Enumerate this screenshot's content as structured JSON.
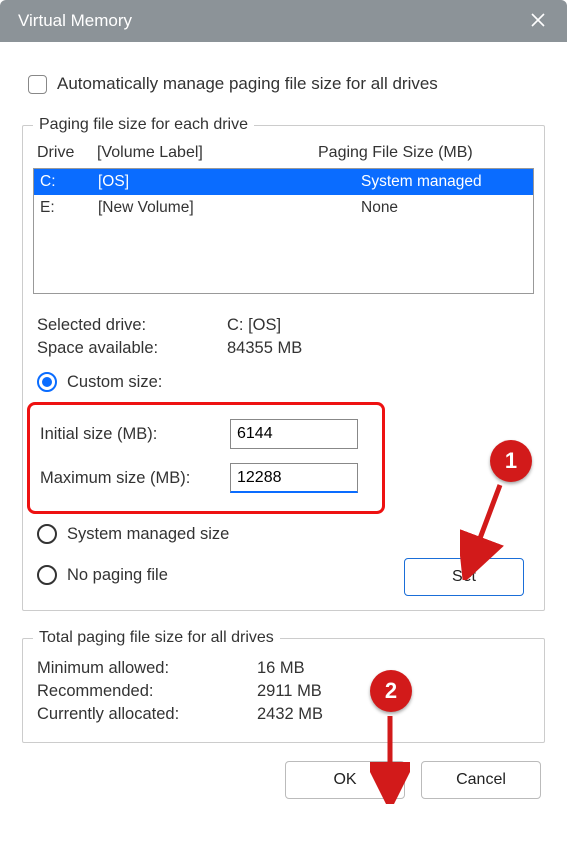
{
  "window": {
    "title": "Virtual Memory"
  },
  "auto_manage": {
    "label": "Automatically manage paging file size for all drives"
  },
  "group_each": {
    "legend": "Paging file size for each drive"
  },
  "cols": {
    "drive": "Drive",
    "vol": "[Volume Label]",
    "size": "Paging File Size (MB)"
  },
  "drives": [
    {
      "letter": "C:",
      "label": "[OS]",
      "size": "System managed",
      "selected": true
    },
    {
      "letter": "E:",
      "label": "[New Volume]",
      "size": "None",
      "selected": false
    }
  ],
  "selected": {
    "label": "Selected drive:",
    "value": "C:  [OS]"
  },
  "space": {
    "label": "Space available:",
    "value": "84355 MB"
  },
  "custom": {
    "label": "Custom size:"
  },
  "initial": {
    "label": "Initial size (MB):",
    "value": "6144"
  },
  "maximum": {
    "label": "Maximum size (MB):",
    "value": "12288"
  },
  "system_managed": {
    "label": "System managed size"
  },
  "no_paging": {
    "label": "No paging file"
  },
  "set": {
    "label": "Set"
  },
  "group_total": {
    "legend": "Total paging file size for all drives"
  },
  "min": {
    "label": "Minimum allowed:",
    "value": "16 MB"
  },
  "rec": {
    "label": "Recommended:",
    "value": "2911 MB"
  },
  "cur": {
    "label": "Currently allocated:",
    "value": "2432 MB"
  },
  "ok": {
    "label": "OK"
  },
  "cancel": {
    "label": "Cancel"
  },
  "anno": {
    "one": "1",
    "two": "2"
  }
}
